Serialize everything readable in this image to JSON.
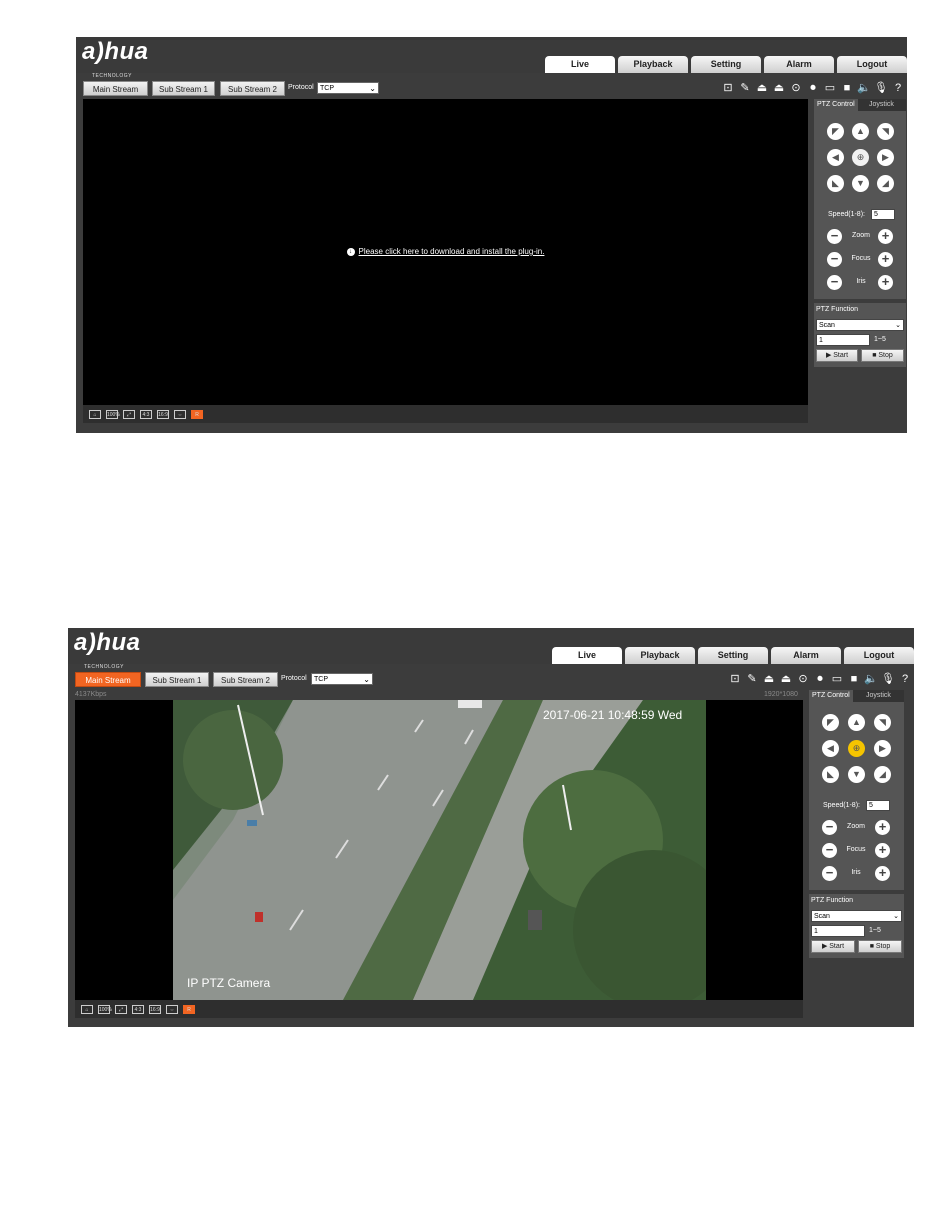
{
  "brand": {
    "logo_text": "a)hua",
    "logo_sub": "TECHNOLOGY"
  },
  "nav": [
    "Live",
    "Playback",
    "Setting",
    "Alarm",
    "Logout"
  ],
  "streams": [
    "Main Stream",
    "Sub Stream 1",
    "Sub Stream 2"
  ],
  "protocol": {
    "label": "Protocol",
    "value": "TCP"
  },
  "plugin_link": "Please click here to download and install the plug-in.",
  "ptz": {
    "tab_control": "PTZ Control",
    "tab_joystick": "Joystick",
    "speed_label": "Speed(1-8):",
    "speed_value": "5",
    "zoom": "Zoom",
    "focus": "Focus",
    "iris": "Iris"
  },
  "ptz_function": {
    "title": "PTZ Function",
    "mode": "Scan",
    "number": "1",
    "range": "1~5",
    "start": "Start",
    "stop": "Stop"
  },
  "video_bar_icons": [
    "home-icon",
    "100%",
    "fullscreen",
    "4:3",
    "16:9",
    "fit",
    "rule"
  ],
  "live2": {
    "bitrate": "4137Kbps",
    "resolution": "1920*1080",
    "osd_time": "2017-06-21 10:48:59 Wed",
    "osd_name": "IP PTZ Camera"
  },
  "colors": {
    "accent": "#f26522",
    "center_active": "#f5c400",
    "frame": "#3c3c3c"
  }
}
